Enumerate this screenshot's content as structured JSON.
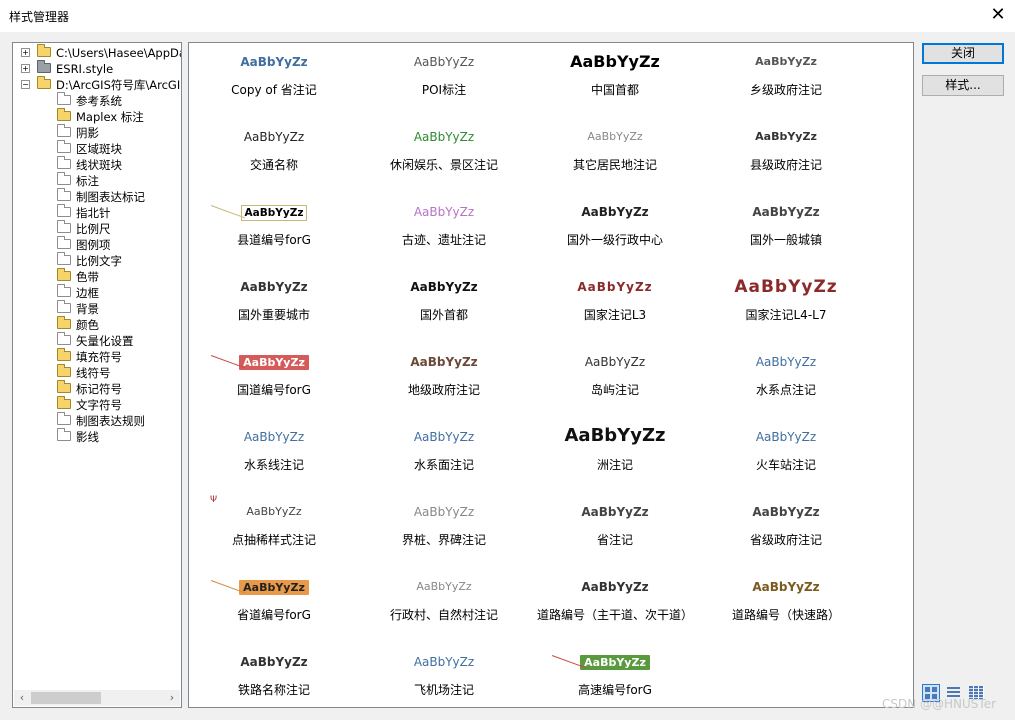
{
  "window": {
    "title": "样式管理器",
    "close_glyph": "✕"
  },
  "buttons": {
    "close": "关闭",
    "styles": "样式..."
  },
  "tree": {
    "roots": [
      {
        "label": "C:\\Users\\Hasee\\AppData",
        "expander": "+",
        "icon": "yellow"
      },
      {
        "label": "ESRI.style",
        "expander": "+",
        "icon": "gray"
      },
      {
        "label": "D:\\ArcGIS符号库\\ArcGIS",
        "expander": "−",
        "icon": "yellow"
      }
    ],
    "children": [
      {
        "label": "参考系统",
        "icon": "white"
      },
      {
        "label": "Maplex 标注",
        "icon": "yellow"
      },
      {
        "label": "阴影",
        "icon": "white"
      },
      {
        "label": "区域斑块",
        "icon": "white"
      },
      {
        "label": "线状斑块",
        "icon": "white"
      },
      {
        "label": "标注",
        "icon": "white"
      },
      {
        "label": "制图表达标记",
        "icon": "white"
      },
      {
        "label": "指北针",
        "icon": "white"
      },
      {
        "label": "比例尺",
        "icon": "white"
      },
      {
        "label": "图例项",
        "icon": "white"
      },
      {
        "label": "比例文字",
        "icon": "white"
      },
      {
        "label": "色带",
        "icon": "yellow"
      },
      {
        "label": "边框",
        "icon": "white"
      },
      {
        "label": "背景",
        "icon": "white"
      },
      {
        "label": "颜色",
        "icon": "yellow"
      },
      {
        "label": "矢量化设置",
        "icon": "white"
      },
      {
        "label": "填充符号",
        "icon": "yellow"
      },
      {
        "label": "线符号",
        "icon": "yellow"
      },
      {
        "label": "标记符号",
        "icon": "yellow"
      },
      {
        "label": "文字符号",
        "icon": "yellow"
      },
      {
        "label": "制图表达规则",
        "icon": "white"
      },
      {
        "label": "影线",
        "icon": "white"
      }
    ]
  },
  "styles": [
    {
      "sample": "AaBbYyZz",
      "label": "Copy of  省注记",
      "color": "#3f6fa0",
      "kind": "bold"
    },
    {
      "sample": "AaBbYyZz",
      "label": "POI标注",
      "color": "#555555",
      "kind": "plain"
    },
    {
      "sample": "AaBbYyZz",
      "label": "中国首都",
      "color": "#000000",
      "kind": "big"
    },
    {
      "sample": "AaBbYyZz",
      "label": "乡级政府注记",
      "color": "#555555",
      "kind": "small-bold"
    },
    {
      "sample": "AaBbYyZz",
      "label": "交通名称",
      "color": "#222222",
      "kind": "plain"
    },
    {
      "sample": "AaBbYyZz",
      "label": "休闲娱乐、景区注记",
      "color": "#2f8a2f",
      "kind": "plain"
    },
    {
      "sample": "AaBbYyZz",
      "label": "其它居民地注记",
      "color": "#888888",
      "kind": "small"
    },
    {
      "sample": "AaBbYyZz",
      "label": "县级政府注记",
      "color": "#333333",
      "kind": "small-bold"
    },
    {
      "sample": "AaBbYyZz",
      "label": "县道编号forG",
      "color": "#000000",
      "kind": "boxed",
      "leader": "#c9b77a"
    },
    {
      "sample": "AaBbYyZz",
      "label": "古迹、遗址注记",
      "color": "#b673c8",
      "kind": "plain"
    },
    {
      "sample": "AaBbYyZz",
      "label": "国外一级行政中心",
      "color": "#222222",
      "kind": "bold"
    },
    {
      "sample": "AaBbYyZz",
      "label": "国外一般城镇",
      "color": "#444444",
      "kind": "bold"
    },
    {
      "sample": "AaBbYyZz",
      "label": "国外重要城市",
      "color": "#333333",
      "kind": "bold"
    },
    {
      "sample": "AaBbYyZz",
      "label": "国外首都",
      "color": "#111111",
      "kind": "bold"
    },
    {
      "sample": "AaBbYyZz",
      "label": "国家注记L3",
      "color": "#8b2a2a",
      "kind": "bold-spaced"
    },
    {
      "sample": "AaBbYyZz",
      "label": "国家注记L4-L7",
      "color": "#8b2a2a",
      "kind": "huge"
    },
    {
      "sample": "AaBbYyZz",
      "label": "国道编号forG",
      "color": "#ffffff",
      "kind": "pill",
      "pill": "#d55b5b",
      "leader": "#c84a4a"
    },
    {
      "sample": "AaBbYyZz",
      "label": "地级政府注记",
      "color": "#6b4a3a",
      "kind": "bold"
    },
    {
      "sample": "AaBbYyZz",
      "label": "岛屿注记",
      "color": "#333333",
      "kind": "plain"
    },
    {
      "sample": "AaBbYyZz",
      "label": "水系点注记",
      "color": "#3f6fa0",
      "kind": "plain"
    },
    {
      "sample": "AaBbYyZz",
      "label": "水系线注记",
      "color": "#3f6fa0",
      "kind": "plain"
    },
    {
      "sample": "AaBbYyZz",
      "label": "水系面注记",
      "color": "#3f6fa0",
      "kind": "plain"
    },
    {
      "sample": "AaBbYyZz",
      "label": "洲注记",
      "color": "#111111",
      "kind": "huge-black"
    },
    {
      "sample": "AaBbYyZz",
      "label": "火车站注记",
      "color": "#3f6fa0",
      "kind": "plain"
    },
    {
      "sample": "AaBbYyZz",
      "label": "点抽稀样式注记",
      "color": "#444444",
      "kind": "small",
      "mark": "Ψ"
    },
    {
      "sample": "AaBbYyZz",
      "label": "界桩、界碑注记",
      "color": "#888888",
      "kind": "plain"
    },
    {
      "sample": "AaBbYyZz",
      "label": "省注记",
      "color": "#444444",
      "kind": "bold"
    },
    {
      "sample": "AaBbYyZz",
      "label": "省级政府注记",
      "color": "#444444",
      "kind": "bold"
    },
    {
      "sample": "AaBbYyZz",
      "label": "省道编号forG",
      "color": "#222222",
      "kind": "pill",
      "pill": "#e9994a",
      "leader": "#d58a3c"
    },
    {
      "sample": "AaBbYyZz",
      "label": "行政村、自然村注记",
      "color": "#888888",
      "kind": "small"
    },
    {
      "sample": "AaBbYyZz",
      "label": "道路编号（主干道、次干道）",
      "color": "#333333",
      "kind": "bold"
    },
    {
      "sample": "AaBbYyZz",
      "label": "道路编号（快速路）",
      "color": "#7a5a1e",
      "kind": "bold"
    },
    {
      "sample": "AaBbYyZz",
      "label": "铁路名称注记",
      "color": "#333333",
      "kind": "bold"
    },
    {
      "sample": "AaBbYyZz",
      "label": "飞机场注记",
      "color": "#3f6fa0",
      "kind": "plain"
    },
    {
      "sample": "AaBbYyZz",
      "label": "高速编号forG",
      "color": "#ffffff",
      "kind": "pill",
      "pill": "#5a9a3e",
      "leader": "#c84a4a"
    }
  ],
  "watermark": "CSDN @@HNUSTer"
}
